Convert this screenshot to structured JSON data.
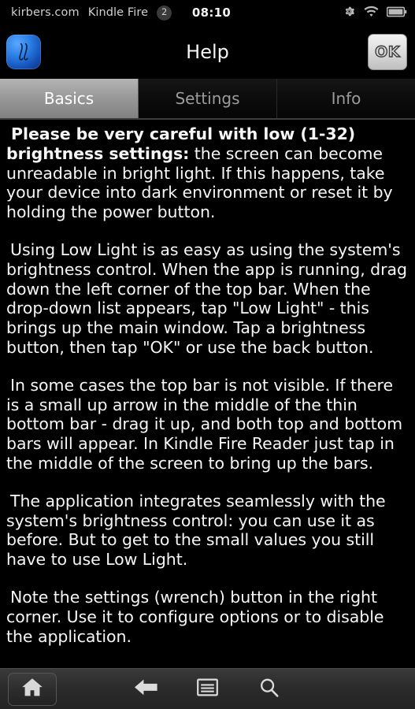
{
  "status_bar": {
    "site": "kirbers.com",
    "device": "Kindle Fire",
    "notification_count": "2",
    "clock": "08:10",
    "icons": [
      "gear-icon",
      "wifi-icon",
      "battery-icon"
    ]
  },
  "action_bar": {
    "app_icon": "low-light-app-icon",
    "title": "Help",
    "ok_label": "OK"
  },
  "tabs": [
    {
      "label": "Basics",
      "selected": true
    },
    {
      "label": "Settings",
      "selected": false
    },
    {
      "label": "Info",
      "selected": false
    }
  ],
  "help": {
    "paragraphs": [
      {
        "lead": "Please be very careful with low (1-32) brightness settings:",
        "text": " the screen can become unreadable in bright light. If this happens, take your device into dark environment or reset it by holding the power button."
      },
      {
        "lead": "",
        "text": "Using Low Light is as easy as using the system's brightness control. When the app is running, drag down the left corner of the top bar. When the drop-down list appears, tap \"Low Light\" - this brings up the main window. Tap a brightness button, then tap \"OK\" or use the back button."
      },
      {
        "lead": "",
        "text": "In some cases the top bar is not visible. If there is a small up arrow in the middle of the thin bottom bar - drag it up, and both top and bottom bars will appear. In Kindle Fire Reader just tap in the middle of the screen to bring up the bars."
      },
      {
        "lead": "",
        "text": "The application integrates seamlessly with the system's brightness control: you can use it as before. But to get to the small values you still have to use Low Light."
      },
      {
        "lead": "",
        "text": "Note the settings (wrench) button in the right corner. Use it to configure options or to disable the application."
      }
    ]
  },
  "nav_bar": {
    "buttons": [
      {
        "name": "home-icon",
        "label": "Home"
      },
      {
        "name": "back-arrow-icon",
        "label": "Back"
      },
      {
        "name": "menu-icon",
        "label": "Menu"
      },
      {
        "name": "search-icon",
        "label": "Search"
      }
    ]
  },
  "colors": {
    "background": "#000000",
    "text": "#f6f6f6",
    "tab_selected": "#9a9a9a",
    "tab_unselected_text": "#9c9c9c",
    "accent_blue": "#2a7de4",
    "navbar": "#2b2b2b"
  }
}
